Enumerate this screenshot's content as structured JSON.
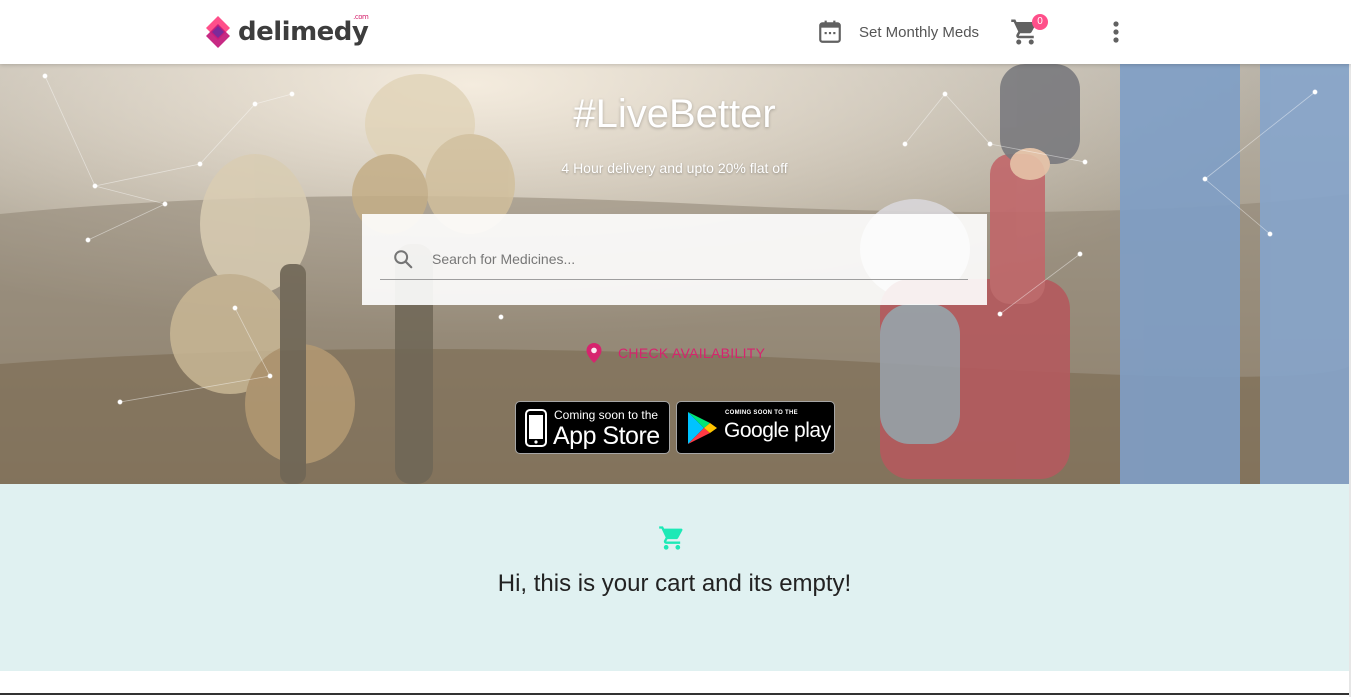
{
  "header": {
    "logo_text": "delimedy",
    "logo_sup": ".com",
    "monthly_meds_label": "Set Monthly Meds",
    "cart_count": "0"
  },
  "hero": {
    "title": "#LiveBetter",
    "subtitle": "4 Hour delivery and upto 20% flat off",
    "search_placeholder": "Search for Medicines...",
    "check_availability_label": "CHECK AVAILABILITY"
  },
  "store_badges": {
    "apple_small": "Coming soon to the",
    "apple_big": "App Store",
    "google_small": "COMING SOON TO THE",
    "google_big": "Google play"
  },
  "cart": {
    "empty_message": "Hi, this is your cart and its empty!"
  },
  "colors": {
    "brand_pink": "#d6246e",
    "brand_purple": "#9b3fb8",
    "cart_badge": "#ff4f8a",
    "cart_icon_green": "#1de9b6",
    "cart_section_bg": "#e0f1f1"
  },
  "icons": [
    "calendar-icon",
    "cart-icon",
    "more-vert-icon",
    "search-icon",
    "location-pin-icon",
    "apple-icon",
    "google-play-icon",
    "cart-empty-icon"
  ]
}
